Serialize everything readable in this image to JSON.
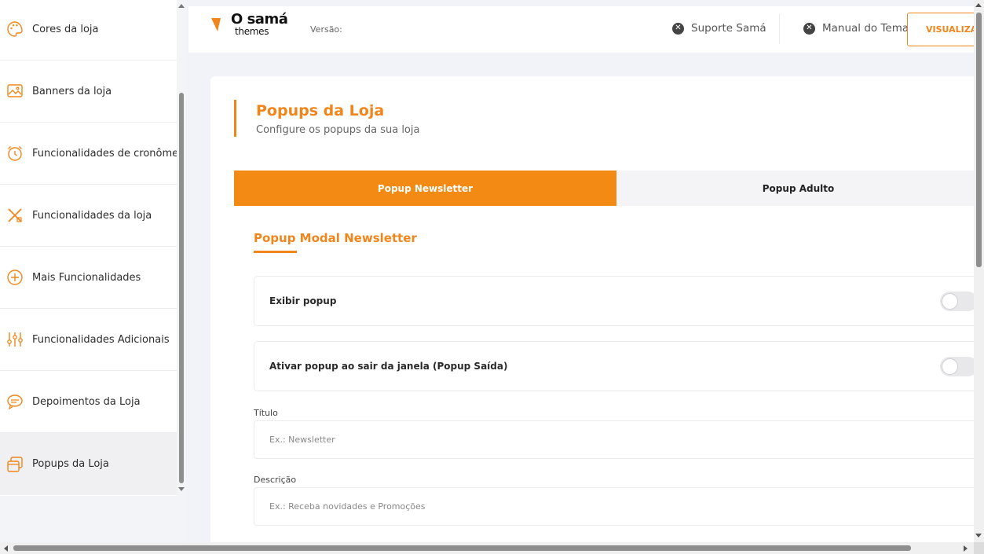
{
  "sidebar": {
    "items": [
      {
        "label": "Cores da loja",
        "icon": "palette-icon"
      },
      {
        "label": "Banners da loja",
        "icon": "image-icon"
      },
      {
        "label": "Funcionalidades de cronômetro",
        "icon": "alarm-clock-icon"
      },
      {
        "label": "Funcionalidades da loja",
        "icon": "tools-icon"
      },
      {
        "label": "Mais Funcionalidades",
        "icon": "plus-circle-icon"
      },
      {
        "label": "Funcionalidades Adicionais",
        "icon": "sliders-icon"
      },
      {
        "label": "Depoimentos da Loja",
        "icon": "chat-bubble-icon"
      },
      {
        "label": "Popups da Loja",
        "icon": "popup-windows-icon",
        "active": true
      }
    ]
  },
  "header": {
    "logo_line1": "samá",
    "logo_line2": "themes",
    "logo_prefix": "O",
    "version_label": "Versão:",
    "support_link": "Suporte Samá",
    "manual_link": "Manual do Tema",
    "visualize_button": "VISUALIZAR"
  },
  "main": {
    "title": "Popups da Loja",
    "subtitle": "Configure os popups da sua loja",
    "tabs": [
      {
        "label": "Popup Newsletter",
        "active": true
      },
      {
        "label": "Popup Adulto",
        "active": false
      }
    ],
    "section_title": "Popup Modal Newsletter",
    "toggles": [
      {
        "label": "Exibir popup",
        "on": false
      },
      {
        "label": "Ativar popup ao sair da janela (Popup Saída)",
        "on": false
      }
    ],
    "fields": [
      {
        "label": "Título",
        "placeholder": "Ex.: Newsletter",
        "value": ""
      },
      {
        "label": "Descrição",
        "placeholder": "Ex.: Receba novidades e Promoções",
        "value": ""
      }
    ]
  },
  "colors": {
    "accent": "#f0861b",
    "tab_active": "#f28a14",
    "sidebar_active": "#f0f0f3"
  }
}
